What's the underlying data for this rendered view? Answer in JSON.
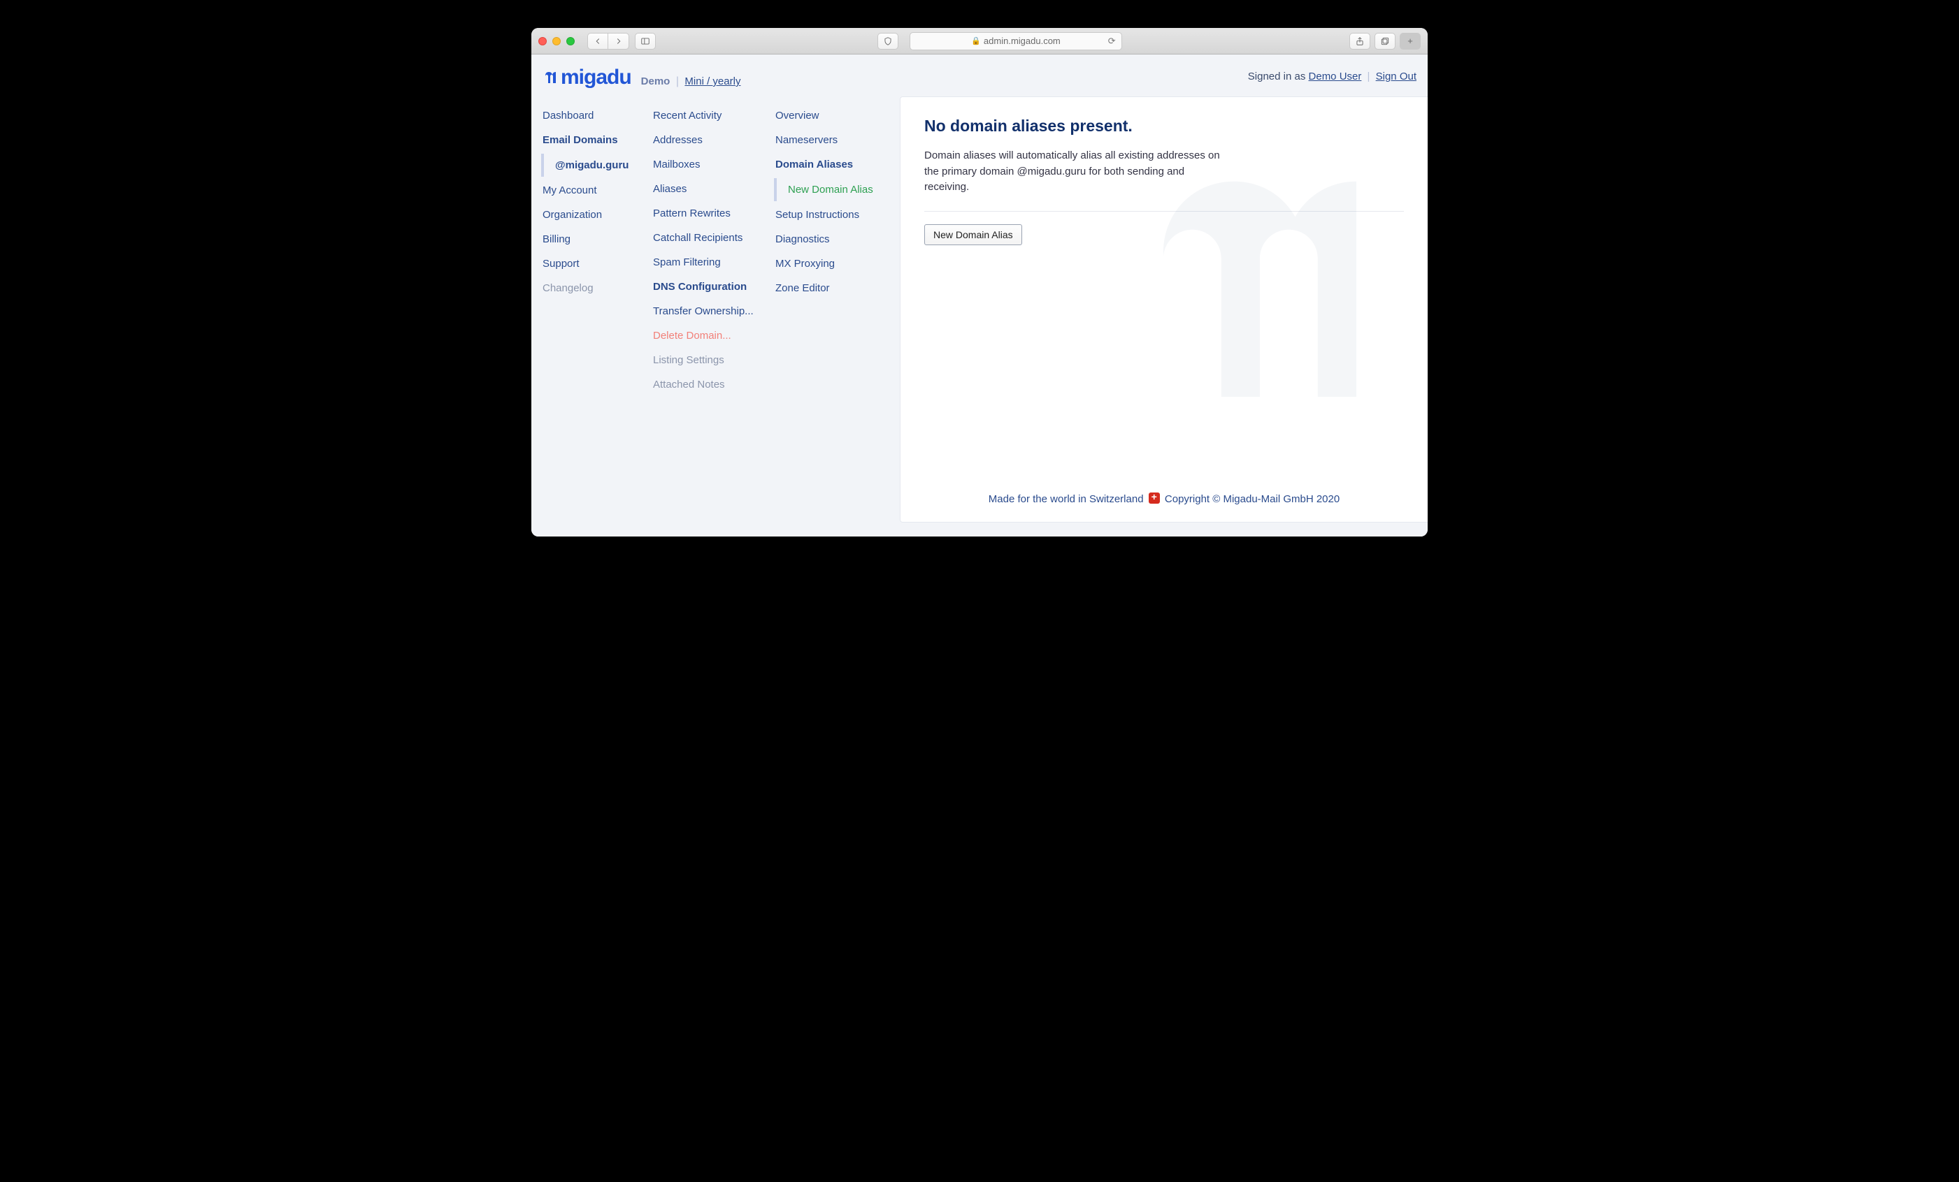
{
  "browser": {
    "url": "admin.migadu.com"
  },
  "header": {
    "logo_text": "migadu",
    "plan_label": "Demo",
    "plan_link": "Mini / yearly",
    "signed_in_prefix": "Signed in as",
    "user": "Demo User",
    "sign_out": "Sign Out"
  },
  "nav": {
    "col1": {
      "dashboard": "Dashboard",
      "email_domains": "Email Domains",
      "domain_sub": "@migadu.guru",
      "my_account": "My Account",
      "organization": "Organization",
      "billing": "Billing",
      "support": "Support",
      "changelog": "Changelog"
    },
    "col2": {
      "recent_activity": "Recent Activity",
      "addresses": "Addresses",
      "mailboxes": "Mailboxes",
      "aliases": "Aliases",
      "pattern_rewrites": "Pattern Rewrites",
      "catchall": "Catchall Recipients",
      "spam": "Spam Filtering",
      "dns_config": "DNS Configuration",
      "transfer": "Transfer Ownership...",
      "delete": "Delete Domain...",
      "listing": "Listing Settings",
      "attached": "Attached Notes"
    },
    "col3": {
      "overview": "Overview",
      "nameservers": "Nameservers",
      "domain_aliases": "Domain Aliases",
      "new_alias": "New Domain Alias",
      "setup": "Setup Instructions",
      "diagnostics": "Diagnostics",
      "mx_proxying": "MX Proxying",
      "zone_editor": "Zone Editor"
    }
  },
  "content": {
    "title": "No domain aliases present.",
    "description": "Domain aliases will automatically alias all existing addresses on the primary domain @migadu.guru for both sending and receiving.",
    "button": "New Domain Alias"
  },
  "footer": {
    "left": "Made for the world in Switzerland",
    "right": "Copyright © Migadu-Mail GmbH 2020"
  }
}
